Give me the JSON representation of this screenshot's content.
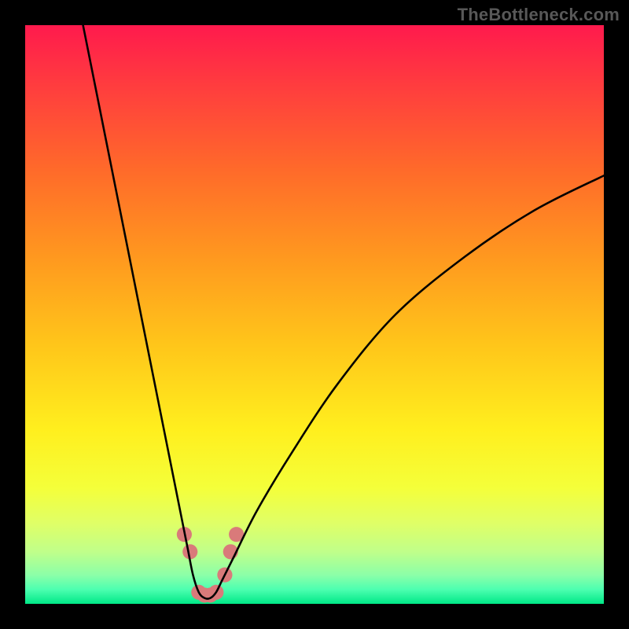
{
  "watermark": "TheBottleneck.com",
  "chart_data": {
    "type": "line",
    "title": "",
    "xlabel": "",
    "ylabel": "",
    "xlim": [
      0,
      100
    ],
    "ylim": [
      0,
      100
    ],
    "series": [
      {
        "name": "bottleneck-curve",
        "x": [
          10,
          14,
          18,
          22,
          26,
          28,
          29,
          30,
          31,
          32,
          33,
          34,
          36,
          40,
          46,
          54,
          64,
          76,
          88,
          100
        ],
        "y": [
          100,
          80,
          60,
          40,
          20,
          10,
          5,
          2,
          1,
          1,
          2,
          4,
          8,
          16,
          26,
          38,
          50,
          60,
          68,
          74
        ]
      }
    ],
    "highlight_band": {
      "description": "coral markers near curve minimum",
      "points": [
        {
          "x": 27.5,
          "y": 12
        },
        {
          "x": 28.5,
          "y": 9
        },
        {
          "x": 30.0,
          "y": 2
        },
        {
          "x": 31.0,
          "y": 1.5
        },
        {
          "x": 32.0,
          "y": 1.5
        },
        {
          "x": 33.0,
          "y": 2
        },
        {
          "x": 34.5,
          "y": 5
        },
        {
          "x": 35.5,
          "y": 9
        },
        {
          "x": 36.5,
          "y": 12
        }
      ]
    },
    "gradient_stops": [
      {
        "offset": 0.0,
        "color": "#ff1a4d"
      },
      {
        "offset": 0.1,
        "color": "#ff3b3f"
      },
      {
        "offset": 0.25,
        "color": "#ff6a2a"
      },
      {
        "offset": 0.4,
        "color": "#ff981f"
      },
      {
        "offset": 0.55,
        "color": "#ffc51a"
      },
      {
        "offset": 0.7,
        "color": "#ffef1e"
      },
      {
        "offset": 0.8,
        "color": "#f4ff3a"
      },
      {
        "offset": 0.86,
        "color": "#e0ff66"
      },
      {
        "offset": 0.91,
        "color": "#c0ff8a"
      },
      {
        "offset": 0.95,
        "color": "#8cffa8"
      },
      {
        "offset": 0.975,
        "color": "#4dffb0"
      },
      {
        "offset": 1.0,
        "color": "#00e887"
      }
    ],
    "colors": {
      "curve": "#000000",
      "highlight": "#d97a7a",
      "frame": "#000000"
    }
  }
}
